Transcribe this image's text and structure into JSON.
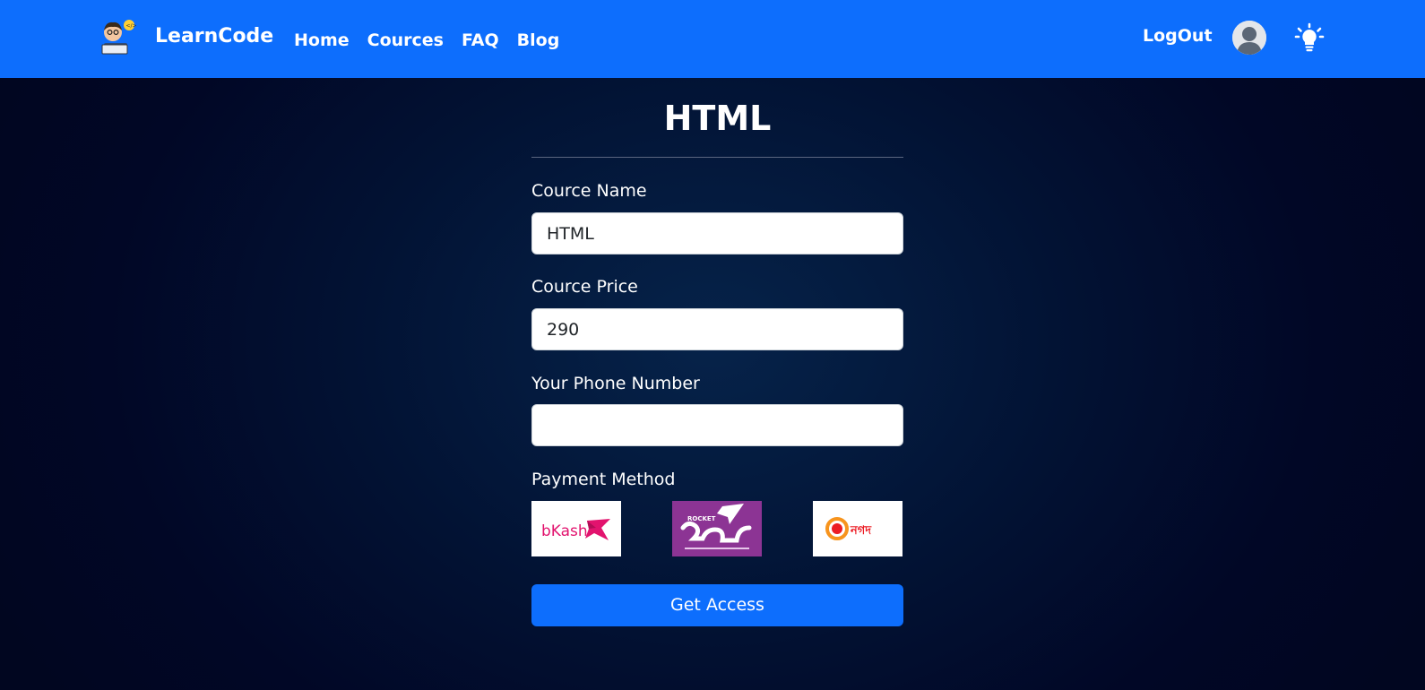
{
  "nav": {
    "brand": "LearnCode",
    "links": [
      "Home",
      "Cources",
      "FAQ",
      "Blog"
    ],
    "logout": "LogOut"
  },
  "course": {
    "title": "HTML"
  },
  "form": {
    "name_label": "Cource Name",
    "name_value": "HTML",
    "price_label": "Cource Price",
    "price_value": "290",
    "phone_label": "Your Phone Number",
    "phone_value": "",
    "payment_label": "Payment Method",
    "payment_methods": [
      "bKash",
      "ROCKET",
      "নগদ"
    ],
    "submit_label": "Get Access"
  },
  "colors": {
    "primary": "#0d6efd",
    "bkash": "#e2136e",
    "rocket": "#8c3494",
    "nagad": "#ec1c24"
  }
}
